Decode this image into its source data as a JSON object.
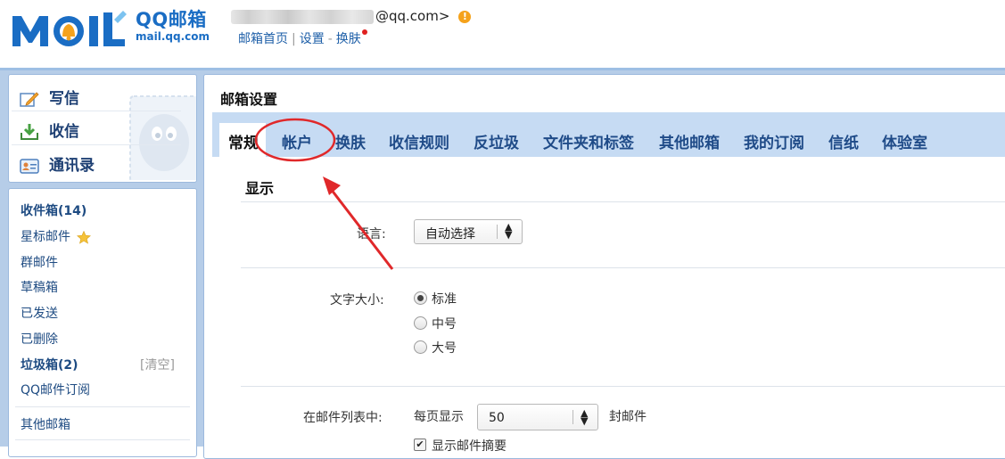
{
  "brand": {
    "logo_letters": "MOIL",
    "name_cn": "QQ邮箱",
    "domain": "mail.qq.com"
  },
  "account": {
    "email_suffix": "@qq.com>",
    "warning_icon": "warning-icon"
  },
  "top_nav": {
    "home": "邮箱首页",
    "separator": "|",
    "settings": "设置",
    "dash": "-",
    "skin": "换肤"
  },
  "sidebar": {
    "compose": "写信",
    "receive": "收信",
    "contacts": "通讯录",
    "folders": {
      "inbox": "收件箱(14)",
      "starred": "星标邮件",
      "group": "群邮件",
      "drafts": "草稿箱",
      "sent": "已发送",
      "deleted": "已删除",
      "spam": "垃圾箱(2)",
      "spam_clear": "[清空]",
      "subscriptions": "QQ邮件订阅",
      "other_mailboxes": "其他邮箱"
    }
  },
  "settings": {
    "title": "邮箱设置",
    "tabs": [
      "常规",
      "帐户",
      "换肤",
      "收信规则",
      "反垃圾",
      "文件夹和标签",
      "其他邮箱",
      "我的订阅",
      "信纸",
      "体验室"
    ],
    "active_tab": "常规",
    "section_display": "显示",
    "language": {
      "label": "语言:",
      "value": "自动选择"
    },
    "font_size": {
      "label": "文字大小:",
      "options": [
        "标准",
        "中号",
        "大号"
      ],
      "selected": "标准"
    },
    "mail_list": {
      "label": "在邮件列表中:",
      "per_page_prefix": "每页显示",
      "per_page_value": "50",
      "per_page_suffix": "封邮件",
      "show_summary": "显示邮件摘要"
    }
  },
  "colors": {
    "brand_blue": "#1a6dc4",
    "frame_blue": "#b6cde8",
    "tabbar_blue": "#c6dbf3",
    "annotation_red": "#e0282a"
  }
}
